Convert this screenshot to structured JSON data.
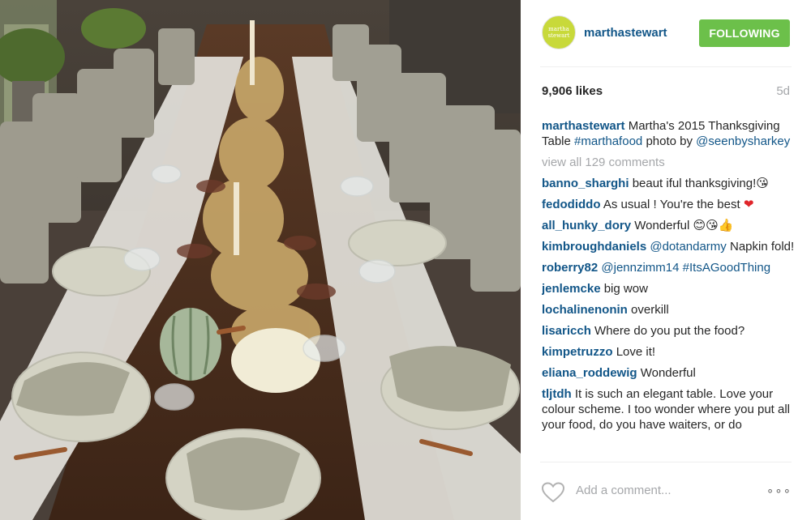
{
  "photo": {
    "alt_icon": "photo-thanksgiving-table"
  },
  "header": {
    "avatar_text_line1": "martha",
    "avatar_text_line2": "stewart",
    "username": "marthastewart",
    "follow_label": "FOLLOWING",
    "follow_color": "#6cc04a"
  },
  "stats": {
    "likes": "9,906 likes",
    "time_ago": "5d"
  },
  "caption": {
    "username": "marthastewart",
    "text_before": "Martha's 2015 Thanksgiving Table",
    "hashtag": "#marthafood",
    "text_middle": "photo by",
    "mention": "@seenbysharkey"
  },
  "view_all": "view all 129 comments",
  "comments": [
    {
      "user": "banno_sharghi",
      "text": "beaut iful thanksgiving!",
      "emoji": "😘"
    },
    {
      "user": "fedodiddo",
      "text": "As usual ! You're the best",
      "emoji": "❤"
    },
    {
      "user": "all_hunky_dory",
      "text": "Wonderful",
      "emoji": "😊😘👍"
    },
    {
      "user": "kimbroughdaniels",
      "mention": "@dotandarmy",
      "text": "Napkin fold!"
    },
    {
      "user": "roberry82",
      "mention": "@jennzimm14",
      "hashtag": "#ItsAGoodThing"
    },
    {
      "user": "jenlemcke",
      "text": "big wow"
    },
    {
      "user": "lochalinenonin",
      "text": "overkill"
    },
    {
      "user": "lisaricch",
      "text": "Where do you put the food?"
    },
    {
      "user": "kimpetruzzo",
      "text": "Love it!"
    },
    {
      "user": "eliana_roddewig",
      "text": "Wonderful"
    },
    {
      "user": "tljtdh",
      "text": "It is such an elegant table. Love your colour scheme. I too wonder where you put all your food, do you have waiters, or do"
    }
  ],
  "footer": {
    "add_comment_placeholder": "Add a comment...",
    "more_label": "∘∘∘"
  },
  "colors": {
    "link": "#125688",
    "muted": "#a5a7aa",
    "divider": "#efefef"
  }
}
